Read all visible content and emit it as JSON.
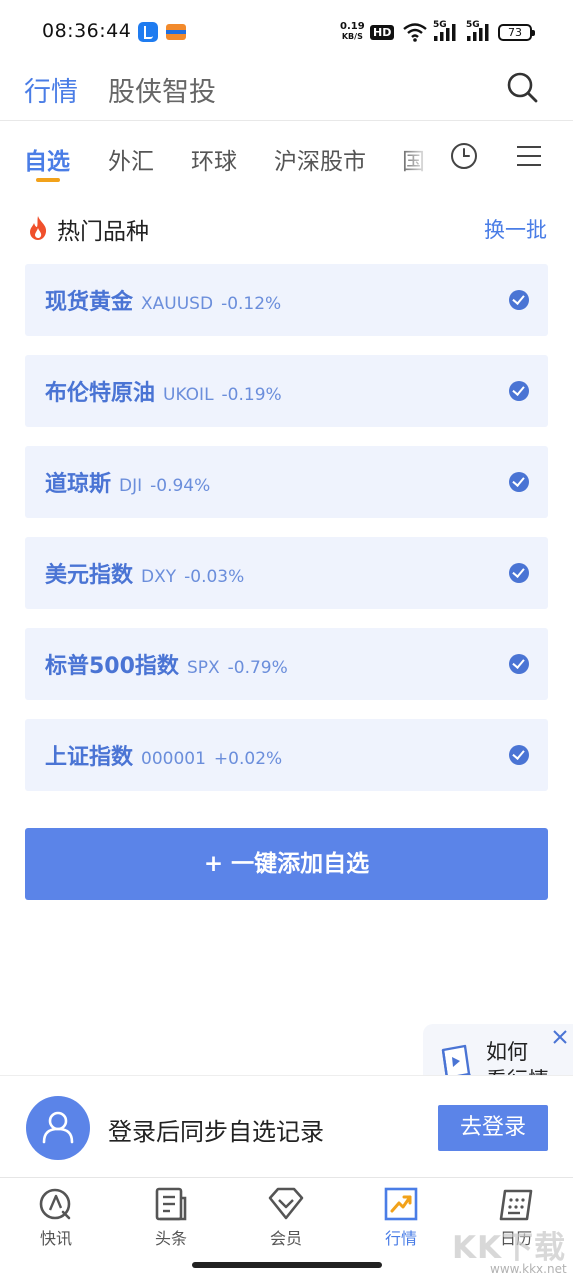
{
  "status_bar": {
    "time": "08:36:44",
    "net_speed": "0.19",
    "net_unit": "KB/S",
    "hd_label": "HD",
    "sig1_label": "5G",
    "sig2_label": "5G",
    "battery": "73"
  },
  "header": {
    "tab_active": "行情",
    "tab_other": "股侠智投",
    "search_icon": "search-icon"
  },
  "category_tabs": [
    {
      "label": "自选"
    },
    {
      "label": "外汇"
    },
    {
      "label": "环球"
    },
    {
      "label": "沪深股市"
    },
    {
      "label": "国"
    }
  ],
  "hot": {
    "title": "热门品种",
    "refresh": "换一批",
    "items": [
      {
        "name": "现货黄金",
        "code": "XAUUSD",
        "change": "-0.12%"
      },
      {
        "name": "布伦特原油",
        "code": "UKOIL",
        "change": "-0.19%"
      },
      {
        "name": "道琼斯",
        "code": "DJI",
        "change": "-0.94%"
      },
      {
        "name": "美元指数",
        "code": "DXY",
        "change": "-0.03%"
      },
      {
        "name": "标普500指数",
        "code": "SPX",
        "change": "-0.79%"
      },
      {
        "name": "上证指数",
        "code": "000001",
        "change": "+0.02%"
      }
    ]
  },
  "add_button": "+ 一键添加自选",
  "howto": {
    "line1": "如何",
    "line2": "看行情"
  },
  "login": {
    "text": "登录后同步自选记录",
    "button": "去登录"
  },
  "bottom_nav": [
    {
      "label": "快讯",
      "icon": "compass-pen-icon"
    },
    {
      "label": "头条",
      "icon": "news-icon"
    },
    {
      "label": "会员",
      "icon": "diamond-icon"
    },
    {
      "label": "行情",
      "icon": "trend-chart-icon"
    },
    {
      "label": "日历",
      "icon": "calendar-icon"
    }
  ],
  "watermark": {
    "text": "KK下载",
    "url": "www.kkx.net"
  },
  "colors": {
    "accent": "#4a7de6",
    "button": "#5b84e8",
    "card_bg": "#eff3fd",
    "underline": "#f2a21a",
    "fire": "#f0502c"
  }
}
